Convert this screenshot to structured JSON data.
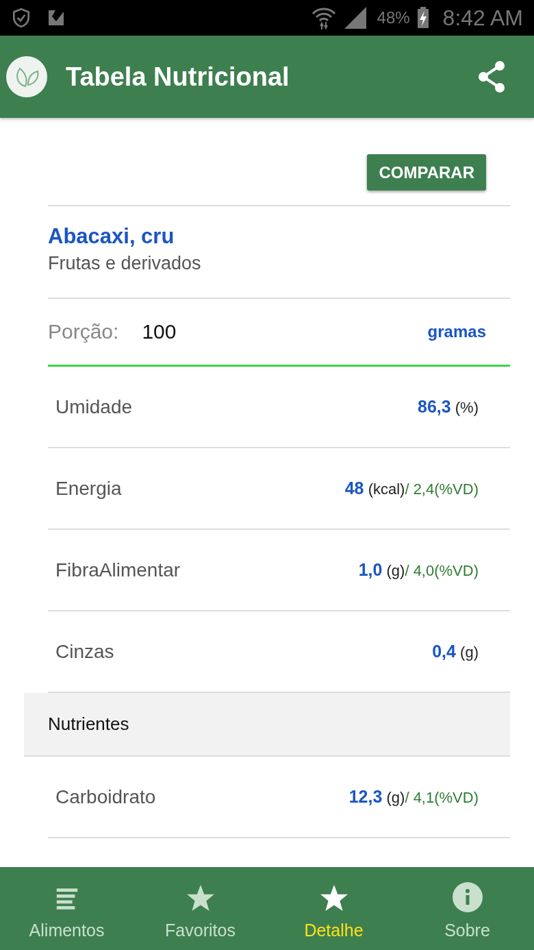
{
  "status_bar": {
    "battery": "48%",
    "time": "8:42 AM"
  },
  "app_bar": {
    "title": "Tabela Nutricional"
  },
  "compare_button": "COMPARAR",
  "food": {
    "name": "Abacaxi, cru",
    "group": "Frutas e derivados"
  },
  "portion": {
    "label": "Porção:",
    "value": "100",
    "unit": "gramas"
  },
  "rows": [
    {
      "kind": "item",
      "label": "Umidade",
      "value": "86,3",
      "unit": "(%)"
    },
    {
      "kind": "item",
      "label": "Energia",
      "value": "48",
      "unit": "(kcal)",
      "vd": "/ 2,4(%VD)"
    },
    {
      "kind": "item",
      "label": "FibraAlimentar",
      "value": "1,0",
      "unit": "(g)",
      "vd": "/ 4,0(%VD)"
    },
    {
      "kind": "item",
      "label": "Cinzas",
      "value": "0,4",
      "unit": "(g)"
    },
    {
      "kind": "section",
      "label": "Nutrientes"
    },
    {
      "kind": "item",
      "label": "Carboidrato",
      "value": "12,3",
      "unit": "(g)",
      "vd": "/ 4,1(%VD)"
    }
  ],
  "bottom_nav": [
    {
      "kind": "list",
      "label": "Alimentos",
      "selected": false
    },
    {
      "kind": "star",
      "label": "Favoritos",
      "selected": false
    },
    {
      "kind": "star",
      "label": "Detalhe",
      "selected": true
    },
    {
      "kind": "info",
      "label": "Sobre",
      "selected": false
    }
  ]
}
